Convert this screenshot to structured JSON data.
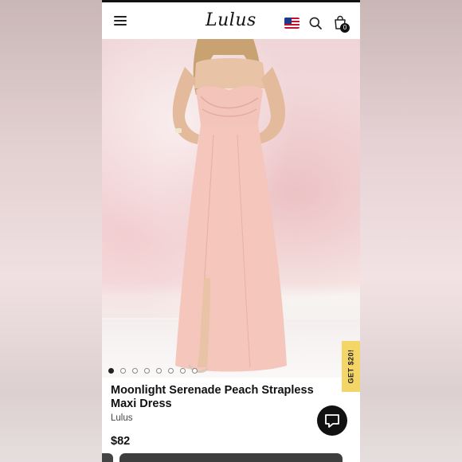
{
  "header": {
    "logo_text": "Lulus",
    "cart_count": "0",
    "icons": [
      "menu-icon",
      "us-flag-icon",
      "search-icon",
      "shopping-bag-icon"
    ]
  },
  "gallery": {
    "dot_count": 8,
    "active_index": 0
  },
  "promo_tab": {
    "label": "GET $20!",
    "color": "#f3d667"
  },
  "product": {
    "title": "Moonlight Serenade Peach Strapless Maxi Dress",
    "brand": "Lulus",
    "price": "$82",
    "dress_color": "#f4c6bc"
  }
}
